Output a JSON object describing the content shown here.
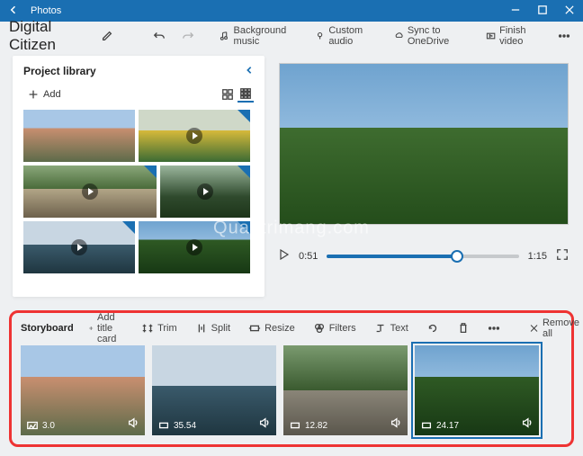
{
  "window": {
    "app_title": "Photos"
  },
  "header": {
    "project_name": "Digital Citizen",
    "buttons": {
      "bg_music": "Background music",
      "custom_audio": "Custom audio",
      "sync": "Sync to OneDrive",
      "finish": "Finish video"
    }
  },
  "library": {
    "title": "Project library",
    "add_label": "Add"
  },
  "player": {
    "current_time": "0:51",
    "total_time": "1:15",
    "progress_pct": 68
  },
  "storyboard": {
    "title": "Storyboard",
    "buttons": {
      "add_title": "Add title card",
      "trim": "Trim",
      "split": "Split",
      "resize": "Resize",
      "filters": "Filters",
      "text": "Text",
      "remove_all": "Remove all"
    },
    "clips": [
      {
        "duration": "3.0",
        "has_motion": true,
        "selected": false,
        "bg": "bg-people"
      },
      {
        "duration": "35.54",
        "has_motion": false,
        "selected": false,
        "bg": "bg-mtn"
      },
      {
        "duration": "12.82",
        "has_motion": false,
        "selected": false,
        "bg": "bg-road"
      },
      {
        "duration": "24.17",
        "has_motion": false,
        "selected": true,
        "bg": "bg-forest"
      }
    ]
  },
  "watermark": "Quantrimang.com"
}
